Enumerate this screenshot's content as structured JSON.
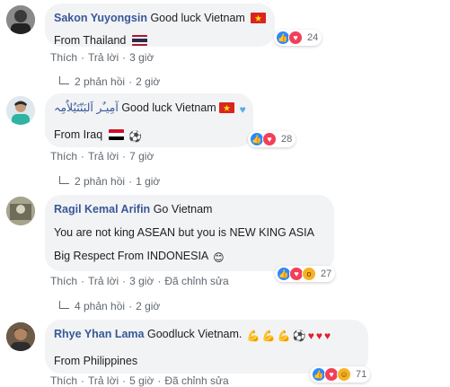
{
  "comments": [
    {
      "name": "Sakon Yuyongsin",
      "text": "Good luck Vietnam",
      "line2": "From Thailand",
      "reaction_count": "24",
      "actions": {
        "like": "Thích",
        "reply": "Trả lời",
        "time": "3 giờ"
      },
      "replies": {
        "count": "2 phản hồi",
        "time": "2 giờ"
      }
    },
    {
      "name": "آمِيـٌر اَلبَنّتَيٌلاٌمِہ",
      "text": "Good luck Vietnam",
      "line2": "From Iraq",
      "reaction_count": "28",
      "actions": {
        "like": "Thích",
        "reply": "Trả lời",
        "time": "7 giờ"
      },
      "replies": {
        "count": "2 phản hồi",
        "time": "1 giờ"
      }
    },
    {
      "name": "Ragil Kemal Arifin",
      "text": "Go Vietnam",
      "line2": "You are not king ASEAN but you is NEW KING ASIA",
      "line3": "Big Respect From INDONESIA",
      "reaction_count": "27",
      "actions": {
        "like": "Thích",
        "reply": "Trả lời",
        "time": "3 giờ",
        "edited": "Đã chỉnh sửa"
      },
      "replies": {
        "count": "4 phản hồi",
        "time": "2 giờ"
      }
    },
    {
      "name": "Rhye Yhan Lama",
      "text": "Goodluck Vietnam.",
      "line2": "From Philippines",
      "reaction_count": "71",
      "actions": {
        "like": "Thích",
        "reply": "Trả lời",
        "time": "5 giờ",
        "edited": "Đã chỉnh sửa"
      }
    }
  ],
  "colors": {
    "name": "#385898",
    "bubble": "#f2f3f5",
    "meta": "#606770"
  }
}
